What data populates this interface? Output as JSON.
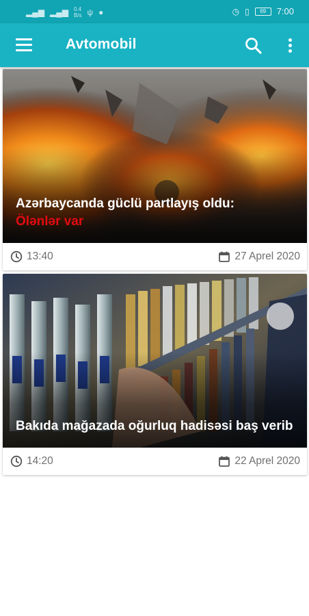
{
  "status_bar": {
    "left_icons": [
      "signal-icon",
      "signal-icon",
      "data-speed-icon",
      "usb-icon",
      "chat-bubble-icon"
    ],
    "network_speed": "0.4\nB/s",
    "battery": "69",
    "time": "7:00"
  },
  "toolbar": {
    "title": "Avtomobil",
    "color": "#1ab3c4"
  },
  "articles": [
    {
      "title_white": "Azərbaycanda güclü partlayış oldu:",
      "title_red": "Ölənlər var",
      "time": "13:40",
      "date": "27 Aprel 2020",
      "image": "explosion-photo"
    },
    {
      "title_white": "Bakıda mağazada oğurluq hadisəsi baş verib",
      "time": "14:20",
      "date": "22 Aprel 2020",
      "image": "liquor-shelf-photo"
    }
  ]
}
